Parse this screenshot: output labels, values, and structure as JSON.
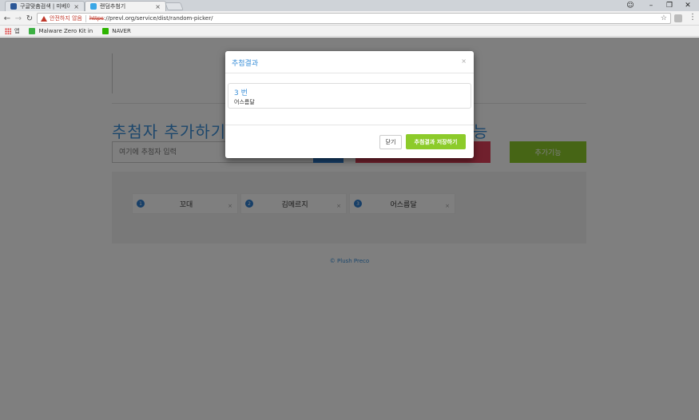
{
  "browser": {
    "tabs": [
      {
        "title": "구글맞춤검색 | 미베이프",
        "favicon_color": "#2b5797"
      },
      {
        "title": "랜덤추첨기",
        "favicon_color": "#3aa7e6"
      }
    ],
    "security_warning": "안전하지 않음",
    "url_scheme": "https",
    "url_rest": "://prevl.org/service/dist/random-picker/",
    "bookmarks": [
      {
        "label": "앱",
        "icon": "apps-grid-icon"
      },
      {
        "label": "Malware Zero Kit in",
        "icon_color": "#3cb043"
      },
      {
        "label": "NAVER",
        "icon_color": "#2db400"
      }
    ],
    "window_controls": {
      "account": "☺",
      "minimize": "–",
      "restore": "❐",
      "close": "✕"
    }
  },
  "page": {
    "section_title": "추첨자 추가하기",
    "section_title_tail": "능",
    "name_input_placeholder": "여기에 추첨자 입력",
    "more_button_label": "추가기능",
    "participants": [
      {
        "number": "1",
        "name": "꼬대"
      },
      {
        "number": "2",
        "name": "김메르지"
      },
      {
        "number": "3",
        "name": "어스름달"
      }
    ],
    "footer": "© Plush Preco"
  },
  "modal": {
    "title": "추첨결과",
    "close_glyph": "×",
    "result_number": "3 번",
    "result_name": "어스름달",
    "close_button": "닫기",
    "save_button": "추첨결과 저장하기"
  },
  "colors": {
    "accent_blue": "#3a8fd8",
    "button_green": "#8ccb2a",
    "button_red": "#e0405a",
    "button_blue": "#2f7fd0"
  }
}
